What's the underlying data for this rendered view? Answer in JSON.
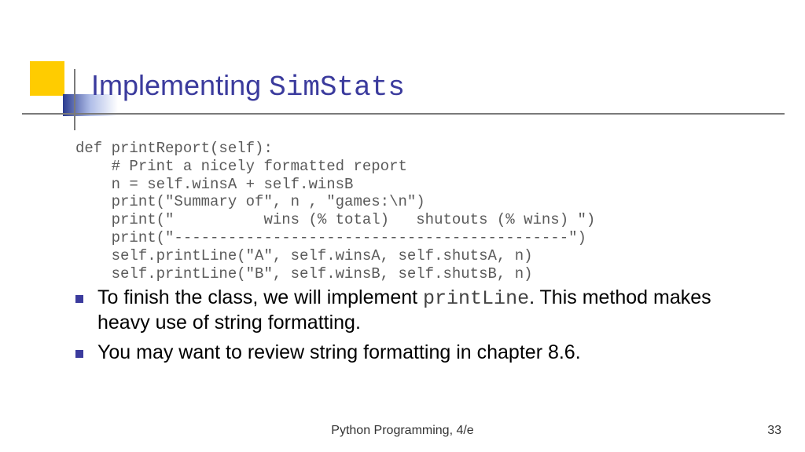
{
  "title": {
    "word": "Implementing ",
    "mono": "SimStats"
  },
  "code": "def printReport(self):\n    # Print a nicely formatted report\n    n = self.winsA + self.winsB\n    print(\"Summary of\", n , \"games:\\n\")\n    print(\"          wins (% total)   shutouts (% wins) \")\n    print(\"--------------------------------------------\")\n    self.printLine(\"A\", self.winsA, self.shutsA, n)\n    self.printLine(\"B\", self.winsB, self.shutsB, n)",
  "bullets": [
    {
      "pre": "To finish the class, we will implement ",
      "mono": "printLine",
      "post": ". This method makes heavy use of string formatting."
    },
    {
      "pre": "You may want to review string formatting in chapter 8.6.",
      "mono": "",
      "post": ""
    }
  ],
  "footer": "Python Programming, 4/e",
  "page_number": "33"
}
